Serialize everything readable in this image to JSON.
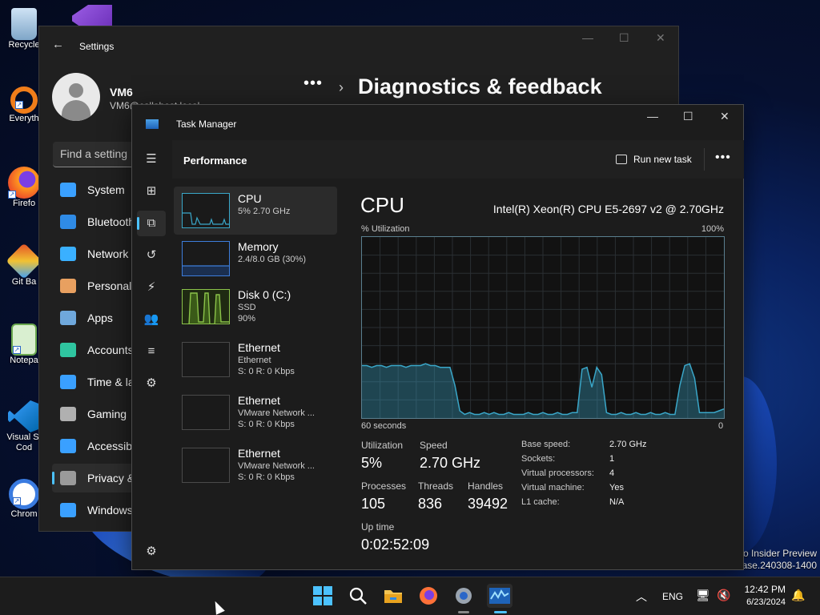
{
  "desktop": {
    "icons": [
      {
        "label": "Recycle",
        "icon": "recycle-bin-icon"
      },
      {
        "label": "Everyth",
        "icon": "everything-search-icon"
      },
      {
        "label": "Firefo",
        "icon": "firefox-icon"
      },
      {
        "label": "Git Ba",
        "icon": "git-bash-icon"
      },
      {
        "label": "Notepa",
        "icon": "notepad-icon"
      },
      {
        "label": "Visual St",
        "label2": "Cod",
        "icon": "vscode-icon"
      },
      {
        "label": "Chrom",
        "icon": "chrome-icon"
      }
    ],
    "watermark": {
      "line1": "ro Insider Preview",
      "line2": "ease.240308-1400"
    }
  },
  "settings": {
    "title": "Settings",
    "user": {
      "name": "VM6",
      "email": "VM6@callahost.local"
    },
    "breadcrumb_more": "•••",
    "page_title": "Diagnostics & feedback",
    "search_placeholder": "Find a setting",
    "nav": [
      {
        "label": "System",
        "icon": "system-icon",
        "color": "#3aa0ff"
      },
      {
        "label": "Bluetooth & devices",
        "icon": "bluetooth-icon",
        "color": "#2f8be6"
      },
      {
        "label": "Network & internet",
        "icon": "wifi-icon",
        "color": "#3ab0ff"
      },
      {
        "label": "Personalization",
        "icon": "brush-icon",
        "color": "#e8a060"
      },
      {
        "label": "Apps",
        "icon": "apps-icon",
        "color": "#6fa8dc"
      },
      {
        "label": "Accounts",
        "icon": "accounts-icon",
        "color": "#2fc5a0"
      },
      {
        "label": "Time & language",
        "icon": "time-icon",
        "color": "#3aa0ff"
      },
      {
        "label": "Gaming",
        "icon": "gaming-icon",
        "color": "#b0b0b0"
      },
      {
        "label": "Accessibility",
        "icon": "accessibility-icon",
        "color": "#3aa0ff"
      },
      {
        "label": "Privacy & security",
        "icon": "shield-icon",
        "color": "#9a9a9a"
      },
      {
        "label": "Windows Update",
        "icon": "update-icon",
        "color": "#3aa0ff"
      }
    ],
    "selected_nav": "Privacy & security"
  },
  "task_manager": {
    "title": "Task Manager",
    "section": "Performance",
    "run_new_task": "Run new task",
    "more": "•••",
    "resources": [
      {
        "name": "CPU",
        "sub1": "5% 2.70 GHz",
        "sub2": ""
      },
      {
        "name": "Memory",
        "sub1": "2.4/8.0 GB (30%)",
        "sub2": ""
      },
      {
        "name": "Disk 0 (C:)",
        "sub1": "SSD",
        "sub2": "90%"
      },
      {
        "name": "Ethernet",
        "sub1": "Ethernet",
        "sub2": "S: 0 R: 0 Kbps"
      },
      {
        "name": "Ethernet",
        "sub1": "VMware Network ...",
        "sub2": "S: 0 R: 0 Kbps"
      },
      {
        "name": "Ethernet",
        "sub1": "VMware Network ...",
        "sub2": "S: 0 R: 0 Kbps"
      }
    ],
    "cpu": {
      "heading": "CPU",
      "model": "Intel(R) Xeon(R) CPU E5-2697 v2 @ 2.70GHz",
      "y_label": "% Utilization",
      "y_max": "100%",
      "x_left": "60 seconds",
      "x_right": "0",
      "utilization_series": [
        29,
        29,
        28,
        29,
        29,
        28,
        29,
        29,
        29,
        28,
        29,
        29,
        29,
        30,
        29,
        29,
        28,
        28,
        28,
        18,
        4,
        2,
        3,
        2,
        2,
        3,
        2,
        3,
        2,
        2,
        3,
        2,
        2,
        2,
        3,
        2,
        2,
        3,
        2,
        2,
        3,
        2,
        2,
        3,
        3,
        27,
        28,
        17,
        28,
        24,
        3,
        2,
        2,
        3,
        2,
        2,
        3,
        2,
        2,
        3,
        2,
        2,
        3,
        2,
        2,
        18,
        29,
        30,
        22,
        3,
        3,
        3,
        3,
        4,
        5
      ],
      "stats": {
        "utilization_label": "Utilization",
        "utilization": "5%",
        "speed_label": "Speed",
        "speed": "2.70 GHz",
        "processes_label": "Processes",
        "processes": "105",
        "threads_label": "Threads",
        "threads": "836",
        "handles_label": "Handles",
        "handles": "39492",
        "uptime_label": "Up time",
        "uptime": "0:02:52:09"
      },
      "specs": [
        {
          "key": "Base speed:",
          "value": "2.70 GHz"
        },
        {
          "key": "Sockets:",
          "value": "1"
        },
        {
          "key": "Virtual processors:",
          "value": "4"
        },
        {
          "key": "Virtual machine:",
          "value": "Yes"
        },
        {
          "key": "L1 cache:",
          "value": "N/A"
        }
      ]
    },
    "colors": {
      "cpu": "#3aa7c9",
      "memory": "#3d7ddb",
      "disk": "#8bc34a",
      "accent": "#4cc2ff"
    }
  },
  "taskbar": {
    "apps": [
      "windows-start-icon",
      "search-icon",
      "file-explorer-icon",
      "firefox-icon",
      "settings-icon",
      "task-manager-icon"
    ],
    "lang": "ENG",
    "time": "12:42 PM",
    "date": "6/23/2024"
  }
}
